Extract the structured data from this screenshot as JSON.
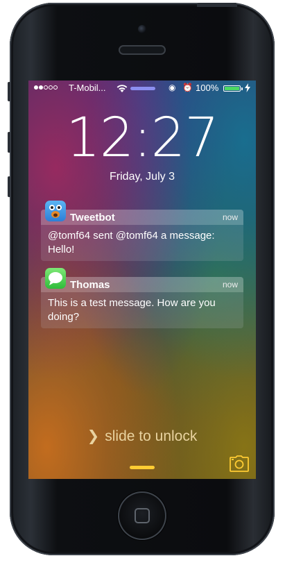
{
  "status_bar": {
    "signal_bars_filled": 2,
    "signal_bars_total": 5,
    "carrier": "T-Mobil...",
    "battery_percent": "100%",
    "battery_color": "#4cd964",
    "icons": [
      "wifi-icon",
      "loading-bar",
      "rotation-lock-icon",
      "alarm-icon",
      "battery-icon",
      "charging-bolt-icon"
    ]
  },
  "lock_screen": {
    "time": "12:27",
    "date": "Friday, July 3",
    "slide_text": "slide to unlock",
    "slide_chevron": "❯",
    "accent_color": "#ffcc33"
  },
  "notifications": [
    {
      "app": "Tweetbot",
      "when": "now",
      "message": "@tomf64 sent @tomf64 a message: Hello!",
      "icon": "tweetbot-app-icon"
    },
    {
      "app": "Thomas",
      "when": "now",
      "message": "This is a test message. How are you doing?",
      "icon": "messages-app-icon"
    }
  ]
}
